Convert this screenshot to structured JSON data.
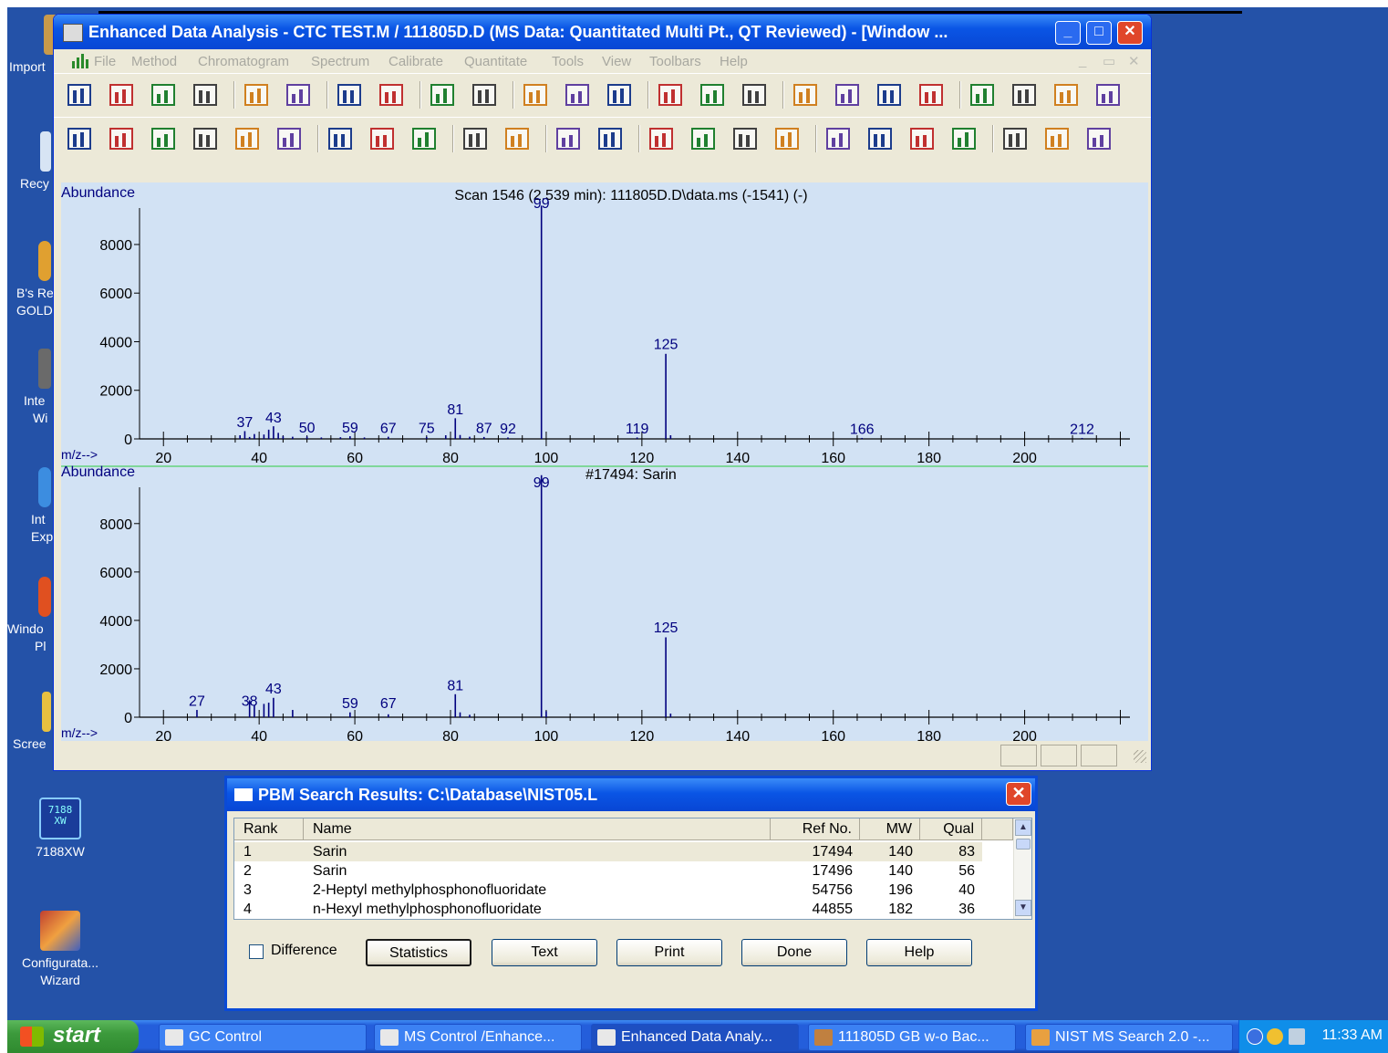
{
  "desktop": {
    "icons": [
      {
        "label_lines": [
          "Import"
        ]
      },
      {
        "label_lines": [
          "Recy"
        ]
      },
      {
        "label_lines": [
          "B's Re",
          "GOLD"
        ]
      },
      {
        "label_lines": [
          "Inte",
          "Wi"
        ]
      },
      {
        "label_lines": [
          "Int",
          "Exp"
        ]
      },
      {
        "label_lines": [
          "Windo",
          "Pl"
        ]
      },
      {
        "label_lines": [
          "Scree"
        ]
      },
      {
        "label_lines": [
          "7188XW"
        ]
      },
      {
        "label_lines": [
          "Configurata...",
          "Wizard"
        ]
      }
    ],
    "icon_7188_text": "7188\nXW"
  },
  "window": {
    "title": "Enhanced Data Analysis - CTC TEST.M / 111805D.D    (MS Data: Quantitated Multi Pt., QT Reviewed) - [Window ...",
    "controls": {
      "minimize": "_",
      "maximize": "□",
      "close": "✕"
    },
    "menu": [
      "File",
      "Method",
      "Chromatogram",
      "Spectrum",
      "Calibrate",
      "Quantitate",
      "Tools",
      "View",
      "Toolbars",
      "Help"
    ],
    "menu_controls": [
      "_",
      "▭",
      "✕"
    ],
    "toolbar1_icons": [
      "select-mode-icon",
      "load-file-icon",
      "save-file-icon",
      "run-icon",
      "tape-icon",
      "print-icon",
      "scan-sim-icon",
      "sim-icon",
      "copy-icon",
      "report-icon",
      "stop-icon",
      "text-icon",
      "color-icon",
      "tree-icon",
      "notes-icon",
      "card-icon",
      "edit-icon",
      "peak-icon",
      "library-icon",
      "spectrum-view-icon",
      "hammer-1-icon",
      "hammer-2-icon",
      "hammer-3-icon",
      "hammer-4-icon"
    ],
    "toolbar2_icons": [
      "compass-icon",
      "chromatogram-icon",
      "integrate-icon",
      "mz-icon",
      "zoom-icon",
      "export-icon",
      "peak-find-icon",
      "peak-list-icon",
      "ratio-icon",
      "bar-stats-icon",
      "bank-icon",
      "building-icon",
      "blank-page-icon",
      "chart-check-icon",
      "chart-edit-icon",
      "chart-up-icon",
      "doc-copy-icon",
      "paste-icon",
      "print-copy-icon",
      "doc-icon",
      "printer-doc-icon",
      "ab-check-icon",
      "hand-icon",
      "red-bar-icon"
    ]
  },
  "chart_data": [
    {
      "type": "bar",
      "title": "Scan 1546 (2.539 min): 111805D.D\\data.ms (-1541) (-)",
      "ylabel": "Abundance",
      "xlabel": "m/z-->",
      "xlim": [
        15,
        222
      ],
      "ylim": [
        0,
        9500
      ],
      "yticks": [
        0,
        2000,
        4000,
        6000,
        8000
      ],
      "xticks": [
        20,
        40,
        60,
        80,
        100,
        120,
        140,
        160,
        180,
        200
      ],
      "peaks": [
        {
          "mz": 36,
          "value": 150
        },
        {
          "mz": 37,
          "value": 320
        },
        {
          "mz": 38,
          "value": 80
        },
        {
          "mz": 39,
          "value": 200
        },
        {
          "mz": 41,
          "value": 180
        },
        {
          "mz": 42,
          "value": 380
        },
        {
          "mz": 43,
          "value": 520
        },
        {
          "mz": 44,
          "value": 250
        },
        {
          "mz": 45,
          "value": 120
        },
        {
          "mz": 47,
          "value": 90
        },
        {
          "mz": 50,
          "value": 100
        },
        {
          "mz": 53,
          "value": 60
        },
        {
          "mz": 57,
          "value": 70
        },
        {
          "mz": 59,
          "value": 110
        },
        {
          "mz": 62,
          "value": 60
        },
        {
          "mz": 67,
          "value": 90
        },
        {
          "mz": 75,
          "value": 80
        },
        {
          "mz": 79,
          "value": 150
        },
        {
          "mz": 81,
          "value": 850
        },
        {
          "mz": 82,
          "value": 160
        },
        {
          "mz": 84,
          "value": 90
        },
        {
          "mz": 87,
          "value": 80
        },
        {
          "mz": 92,
          "value": 60
        },
        {
          "mz": 99,
          "value": 9600
        },
        {
          "mz": 119,
          "value": 60
        },
        {
          "mz": 125,
          "value": 3500
        },
        {
          "mz": 126,
          "value": 150
        },
        {
          "mz": 166,
          "value": 40
        },
        {
          "mz": 212,
          "value": 40
        }
      ],
      "labels": [
        {
          "mz": 37,
          "value": 330,
          "text": "37"
        },
        {
          "mz": 43,
          "value": 530,
          "text": "43"
        },
        {
          "mz": 50,
          "value": 110,
          "text": "50"
        },
        {
          "mz": 59,
          "value": 120,
          "text": "59"
        },
        {
          "mz": 67,
          "value": 100,
          "text": "67"
        },
        {
          "mz": 75,
          "value": 90,
          "text": "75"
        },
        {
          "mz": 81,
          "value": 860,
          "text": "81"
        },
        {
          "mz": 87,
          "value": 90,
          "text": "87"
        },
        {
          "mz": 92,
          "value": 70,
          "text": "92"
        },
        {
          "mz": 99,
          "value": 9350,
          "text": "99"
        },
        {
          "mz": 119,
          "value": 70,
          "text": "119"
        },
        {
          "mz": 125,
          "value": 3550,
          "text": "125"
        },
        {
          "mz": 166,
          "value": 50,
          "text": "166"
        },
        {
          "mz": 212,
          "value": 50,
          "text": "212"
        }
      ]
    },
    {
      "type": "bar",
      "title": "#17494: Sarin",
      "ylabel": "Abundance",
      "xlabel": "m/z-->",
      "xlim": [
        15,
        222
      ],
      "ylim": [
        0,
        9500
      ],
      "yticks": [
        0,
        2000,
        4000,
        6000,
        8000
      ],
      "xticks": [
        20,
        40,
        60,
        80,
        100,
        120,
        140,
        160,
        180,
        200
      ],
      "peaks": [
        {
          "mz": 27,
          "value": 300
        },
        {
          "mz": 38,
          "value": 700
        },
        {
          "mz": 39,
          "value": 500
        },
        {
          "mz": 41,
          "value": 550
        },
        {
          "mz": 42,
          "value": 600
        },
        {
          "mz": 43,
          "value": 800
        },
        {
          "mz": 47,
          "value": 300
        },
        {
          "mz": 59,
          "value": 200
        },
        {
          "mz": 67,
          "value": 120
        },
        {
          "mz": 81,
          "value": 950
        },
        {
          "mz": 82,
          "value": 200
        },
        {
          "mz": 84,
          "value": 100
        },
        {
          "mz": 99,
          "value": 9999
        },
        {
          "mz": 100,
          "value": 250
        },
        {
          "mz": 125,
          "value": 3300
        },
        {
          "mz": 126,
          "value": 150
        }
      ],
      "labels": [
        {
          "mz": 27,
          "value": 320,
          "text": "27"
        },
        {
          "mz": 38,
          "value": 320,
          "text": "38"
        },
        {
          "mz": 43,
          "value": 820,
          "text": "43"
        },
        {
          "mz": 59,
          "value": 220,
          "text": "59"
        },
        {
          "mz": 67,
          "value": 220,
          "text": "67"
        },
        {
          "mz": 81,
          "value": 970,
          "text": "81"
        },
        {
          "mz": 99,
          "value": 9350,
          "text": "99"
        },
        {
          "mz": 125,
          "value": 3350,
          "text": "125"
        }
      ]
    }
  ],
  "dialog": {
    "title": "PBM Search Results: C:\\Database\\NIST05.L",
    "close": "✕",
    "columns": [
      "Rank",
      "Name",
      "Ref No.",
      "MW",
      "Qual"
    ],
    "rows": [
      {
        "rank": "1",
        "name": "Sarin",
        "ref": "17494",
        "mw": "140",
        "qual": "83"
      },
      {
        "rank": "2",
        "name": "Sarin",
        "ref": "17496",
        "mw": "140",
        "qual": "56"
      },
      {
        "rank": "3",
        "name": "2-Heptyl methylphosphonofluoridate",
        "ref": "54756",
        "mw": "196",
        "qual": "40"
      },
      {
        "rank": "4",
        "name": "n-Hexyl methylphosphonofluoridate",
        "ref": "44855",
        "mw": "182",
        "qual": "36"
      }
    ],
    "difference_label": "Difference",
    "difference_checked": false,
    "buttons": [
      "Statistics",
      "Text",
      "Print",
      "Done",
      "Help"
    ]
  },
  "taskbar": {
    "start": "start",
    "tasks": [
      {
        "label": "GC Control",
        "active": false
      },
      {
        "label": "MS Control /Enhance...",
        "active": false
      },
      {
        "label": "Enhanced Data Analy...",
        "active": true
      },
      {
        "label": "111805D GB w-o Bac...",
        "active": false
      },
      {
        "label": "NIST MS Search 2.0 -...",
        "active": false
      }
    ],
    "clock": "11:33 AM"
  },
  "colors": {
    "desktop": "#2452a8",
    "plot_bg": "#d2e2f4",
    "spectrum": "#00007f",
    "separator": "#2ecc40"
  }
}
